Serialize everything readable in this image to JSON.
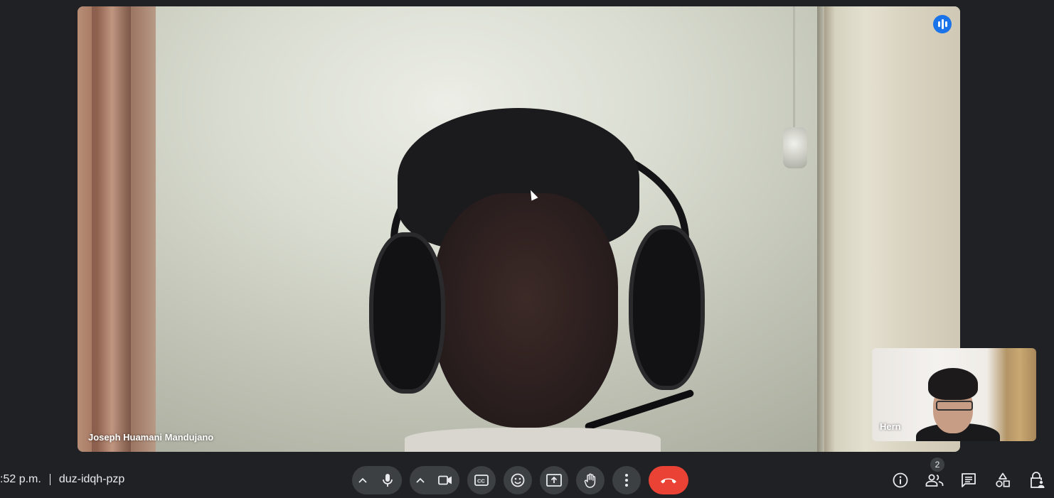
{
  "main_video": {
    "participant_name": "Joseph Huamani Mandujano",
    "speaking_indicator_icon": "audio-levels-icon"
  },
  "self_view": {
    "participant_name": "Hern"
  },
  "meeting_info": {
    "time": ":52 p.m.",
    "meeting_code": "duz-idqh-pzp"
  },
  "controls": {
    "mic_options_icon": "chevron-up-icon",
    "mic_icon": "microphone-icon",
    "camera_options_icon": "chevron-up-icon",
    "camera_icon": "videocam-icon",
    "captions_icon": "closed-captions-icon",
    "reactions_icon": "emoji-icon",
    "present_icon": "present-screen-icon",
    "raise_hand_icon": "hand-icon",
    "more_options_icon": "more-vert-icon",
    "end_call_icon": "call-end-icon"
  },
  "right_controls": {
    "info_icon": "info-icon",
    "people_icon": "people-icon",
    "people_count": "2",
    "chat_icon": "chat-icon",
    "activities_icon": "shapes-icon",
    "host_controls_icon": "lock-person-icon"
  },
  "colors": {
    "background": "#202124",
    "control_bg": "#3c4043",
    "end_call": "#ea4335",
    "speaking_badge": "#1a73e8"
  }
}
